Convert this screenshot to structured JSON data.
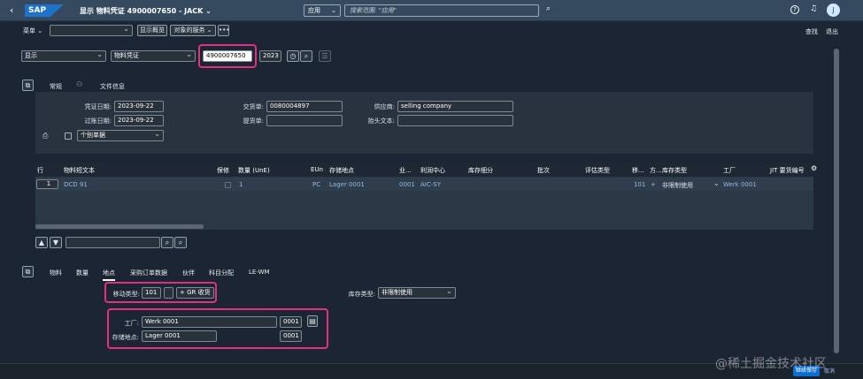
{
  "shell": {
    "logo": "SAP",
    "title": "显示 物料凭证 4900007650 - JACK",
    "scope": "应用",
    "search_placeholder": "搜索范围: \"应用\"",
    "avatar": "J"
  },
  "toolbar": {
    "menu": "菜单",
    "overview_btn": "显示概览",
    "services_btn": "对象的服务",
    "more": "•••",
    "find": "查找",
    "exit": "退出"
  },
  "header": {
    "action": "显示",
    "doc_type": "物料凭证",
    "doc_number": "4900007650",
    "year": "2023"
  },
  "tabs": [
    "常规",
    "文件信息"
  ],
  "general": {
    "doc_date_label": "凭证日期:",
    "doc_date": "2023-09-22",
    "post_date_label": "过账日期:",
    "post_date": "2023-09-22",
    "delivery_label": "交货单:",
    "delivery": "0080004897",
    "bol_label": "提货单:",
    "bol": "",
    "vendor_label": "供应商:",
    "vendor": "selling company",
    "header_text_label": "抬头文本:",
    "header_text": "",
    "slip_select": "个别单据"
  },
  "table": {
    "headers": [
      "行",
      "物料短文本",
      "保修",
      "数量 (UnE)",
      "EUn",
      "存储地点",
      "业...",
      "利润中心",
      "库存细分",
      "批次",
      "评估类型",
      "移...",
      "方...",
      "库存类型",
      "工厂",
      "JIT 要货编号"
    ],
    "row": {
      "line": "1",
      "text": "DCD 91",
      "qty": "1",
      "unit": "PC",
      "sloc": "Lager 0001",
      "biz": "0001",
      "profit": "AIC-SY",
      "mvt": "101",
      "dir": "+",
      "stock_type": "非限制使用",
      "plant": "Werk 0001"
    }
  },
  "detail_tabs": [
    "物料",
    "数量",
    "地点",
    "采购订单数据",
    "伙伴",
    "科目分配",
    "LE-WM"
  ],
  "detail": {
    "mvt_label": "移动类型:",
    "mvt": "101",
    "mvt_text": "+ GR 收货",
    "stock_type_label": "库存类型:",
    "stock_type": "非限制使用",
    "plant_label": "工厂:",
    "plant_name": "Werk 0001",
    "plant_code": "0001",
    "sloc_label": "存储地点:",
    "sloc_name": "Lager 0001",
    "sloc_code": "0001"
  },
  "footer": {
    "save": "继续保存",
    "cancel": "取消"
  },
  "watermark": "@稀土掘金技术社区"
}
